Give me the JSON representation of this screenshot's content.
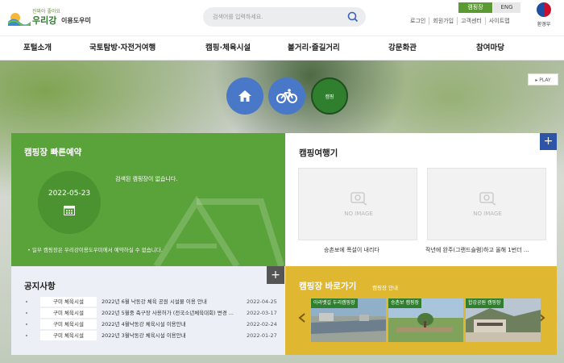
{
  "header": {
    "logo_tagline": "진짜아 좋아요",
    "logo_brand": "우리강",
    "logo_sub": "이용도우미",
    "search_placeholder": "검색어를 입력하세요.",
    "lang_ko": "캠핑장",
    "lang_en": "ENG",
    "util_links": [
      "로그인",
      "회원가입",
      "고객센터",
      "사이트맵"
    ],
    "gov_name": "환경부"
  },
  "gnb": [
    "포털소개",
    "국토탐방·자전거여행",
    "캠핑·체육시설",
    "볼거리·즐길거리",
    "강문화관",
    "참여마당"
  ],
  "visual": {
    "camp_circle_label": "캠핑",
    "play_label": "PLAY"
  },
  "reserve": {
    "title": "캠핑장 빠른예약",
    "date": "2022-05-23",
    "empty_message": "검색된 캠핑장이 없습니다.",
    "note": "• 일부 캠핑장은 우리강이용도우미에서 예약하실 수 없습니다."
  },
  "travel": {
    "title": "캠핑여행기",
    "more": "+",
    "items": [
      {
        "image_text": "NO IMAGE",
        "caption": "승촌보에 폭설이 내리다"
      },
      {
        "image_text": "NO IMAGE",
        "caption": "작년에 완주(그랜드슬램)하고 올해 1번더 ..."
      }
    ]
  },
  "notice": {
    "title": "공지사항",
    "more": "+",
    "rows": [
      {
        "category": "구미 체육시설",
        "title": "2022년 6월 낙동강 체육 공원 시설물 이용 안내",
        "date": "2022-04-25"
      },
      {
        "category": "구미 체육시설",
        "title": "2022년 5월중 축구장 사용허가 (전국소년체육대회) 변경 ...",
        "date": "2022-03-17"
      },
      {
        "category": "구미 체육시설",
        "title": "2022년 4월낙동강 체육시설 이용안내",
        "date": "2022-02-24"
      },
      {
        "category": "구미 체육시설",
        "title": "2022년 3월낙동강 체육시설 이용안내",
        "date": "2022-01-27"
      }
    ]
  },
  "shortcut": {
    "title": "캠핑장 바로가기",
    "subtitle": "캠핑장 안내",
    "thumbs": [
      "아라뱃길 두리캠핑장",
      "승촌보 캠핑장",
      "합강공원 캠핑장"
    ]
  },
  "colors": {
    "green_panel": "#5aa23a",
    "yellow_panel": "#dfb730",
    "blue_circle": "#4a78c8",
    "notice_bg": "#eceff5"
  }
}
